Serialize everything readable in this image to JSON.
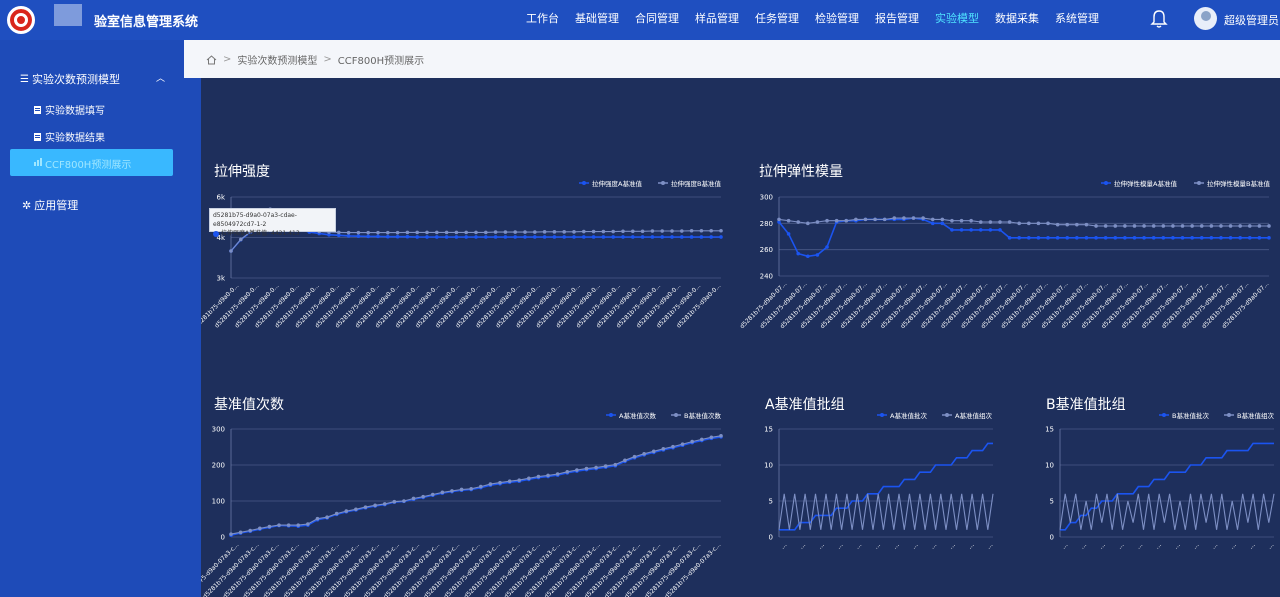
{
  "header": {
    "app_title": "验室信息管理系统",
    "nav": [
      "工作台",
      "基础管理",
      "合同管理",
      "样品管理",
      "任务管理",
      "检验管理",
      "报告管理",
      "实验模型",
      "数据采集",
      "系统管理"
    ],
    "active_nav": "实验模型",
    "user_name": "超级管理员"
  },
  "sidebar": {
    "group_label": "实验次数预测模型",
    "items": [
      "实验数据填写",
      "实验数据结果",
      "CCF800H预测展示"
    ],
    "active_item": "CCF800H预测展示",
    "app_label": "应用管理"
  },
  "breadcrumb": [
    "实验次数预测模型",
    "CCF800H预测展示"
  ],
  "tooltip": {
    "title": "d5281b75-d9a0-07a3-cdae-e8504972cd7-1-2",
    "series": "拉伸强度A基准值",
    "value": "4421.413"
  },
  "colors": {
    "seriesA": "#1b54f0",
    "seriesB": "#7d8fc4",
    "panel": "#1e2f5c",
    "accent": "#39b8ff"
  },
  "chart_data": [
    {
      "type": "line",
      "title": "拉伸强度",
      "tick_label_pattern": "d5281b75-d9a0-0...",
      "yticks": [
        "3k",
        "4k",
        "6k"
      ],
      "ylim": [
        3000,
        6000
      ],
      "grid": true,
      "legend": "top-right",
      "series": [
        {
          "name": "拉伸强度A基准值",
          "values": [
            4000,
            4420,
            4700,
            5200,
            5500,
            5100,
            4900,
            4800,
            4700,
            4650,
            4600,
            4580,
            4560,
            4550,
            4540,
            4540,
            4530,
            4530,
            4530,
            4520,
            4520,
            4520,
            4520,
            4520,
            4520,
            4520,
            4520,
            4520,
            4520,
            4520,
            4520,
            4520,
            4520,
            4520,
            4520,
            4520,
            4520,
            4520,
            4520,
            4520,
            4520,
            4520,
            4520,
            4520,
            4520,
            4520,
            4520,
            4520,
            4520,
            4520,
            4520
          ]
        },
        {
          "name": "拉伸强度B基准值",
          "values": [
            4000,
            4430,
            4720,
            5250,
            5550,
            5300,
            5100,
            4950,
            4800,
            4720,
            4700,
            4690,
            4680,
            4680,
            4680,
            4680,
            4680,
            4680,
            4690,
            4690,
            4690,
            4690,
            4690,
            4690,
            4690,
            4690,
            4690,
            4700,
            4700,
            4700,
            4700,
            4700,
            4710,
            4710,
            4710,
            4710,
            4720,
            4720,
            4720,
            4720,
            4730,
            4730,
            4730,
            4740,
            4740,
            4740,
            4740,
            4750,
            4750,
            4750,
            4750
          ]
        }
      ]
    },
    {
      "type": "line",
      "title": "拉伸弹性模量",
      "tick_label_pattern": "d5281b75-d9a0-07...",
      "yticks": [
        "240",
        "260",
        "280",
        "300"
      ],
      "ylim": [
        240,
        300
      ],
      "grid": true,
      "legend": "top-right",
      "series": [
        {
          "name": "拉伸弹性模量A基准值",
          "values": [
            281,
            272,
            257,
            255,
            256,
            262,
            281,
            282,
            282,
            283,
            283,
            283,
            283,
            283,
            284,
            283,
            280,
            280,
            275,
            275,
            275,
            275,
            275,
            275,
            269,
            269,
            269,
            269,
            269,
            269,
            269,
            269,
            269,
            269,
            269,
            269,
            269,
            269,
            269,
            269,
            269,
            269,
            269,
            269,
            269,
            269,
            269,
            269,
            269,
            269,
            269,
            269
          ]
        },
        {
          "name": "拉伸弹性模量B基准值",
          "values": [
            283,
            282,
            281,
            280,
            281,
            282,
            282,
            282,
            283,
            283,
            283,
            283,
            284,
            284,
            284,
            284,
            283,
            283,
            282,
            282,
            282,
            281,
            281,
            281,
            281,
            280,
            280,
            280,
            280,
            279,
            279,
            279,
            279,
            278,
            278,
            278,
            278,
            278,
            278,
            278,
            278,
            278,
            278,
            278,
            278,
            278,
            278,
            278,
            278,
            278,
            278,
            278
          ]
        }
      ]
    },
    {
      "type": "line",
      "title": "基准值次数",
      "tick_label_pattern": "d5281b75-d9a0-07a3-c...",
      "yticks": [
        "0",
        "100",
        "200",
        "300"
      ],
      "ylim": [
        0,
        300
      ],
      "grid": true,
      "legend": "top-right",
      "series": [
        {
          "name": "A基准值次数",
          "values": [
            5,
            11,
            16,
            22,
            27,
            32,
            31,
            30,
            33,
            48,
            53,
            63,
            70,
            75,
            81,
            86,
            90,
            97,
            99,
            105,
            110,
            116,
            122,
            126,
            130,
            132,
            137,
            144,
            148,
            152,
            155,
            160,
            165,
            168,
            172,
            178,
            183,
            187,
            190,
            194,
            198,
            210,
            220,
            228,
            235,
            242,
            248,
            255,
            262,
            268,
            274,
            278
          ]
        },
        {
          "name": "B基准值次数",
          "values": [
            8,
            13,
            18,
            24,
            29,
            33,
            33,
            33,
            36,
            51,
            55,
            65,
            72,
            77,
            83,
            88,
            92,
            98,
            100,
            107,
            112,
            118,
            124,
            128,
            132,
            134,
            140,
            147,
            151,
            155,
            158,
            163,
            168,
            171,
            175,
            181,
            186,
            190,
            193,
            197,
            201,
            213,
            223,
            231,
            238,
            245,
            251,
            258,
            265,
            271,
            277,
            281
          ]
        }
      ]
    },
    {
      "type": "line",
      "title": "A基准值批组",
      "tick_label_pattern": "…",
      "yticks": [
        "0",
        "5",
        "10",
        "15"
      ],
      "ylim": [
        0,
        15
      ],
      "grid": true,
      "legend": "top-right",
      "series": [
        {
          "name": "A基准值批次",
          "values": [
            1,
            1,
            1,
            1,
            2,
            2,
            2,
            3,
            3,
            3,
            3,
            4,
            4,
            4,
            5,
            5,
            5,
            6,
            6,
            6,
            7,
            7,
            7,
            7,
            8,
            8,
            8,
            9,
            9,
            9,
            10,
            10,
            10,
            10,
            11,
            11,
            11,
            12,
            12,
            12,
            13,
            13
          ]
        },
        {
          "name": "A基准值组次",
          "values": [
            1,
            6,
            1,
            6,
            1,
            6,
            1,
            6,
            1,
            6,
            1,
            6,
            1,
            6,
            1,
            6,
            1,
            6,
            1,
            6,
            1,
            6,
            1,
            6,
            1,
            6,
            1,
            6,
            1,
            6,
            1,
            6,
            1,
            6,
            1,
            6,
            1,
            6,
            1,
            6,
            1,
            6
          ]
        }
      ]
    },
    {
      "type": "line",
      "title": "B基准值批组",
      "tick_label_pattern": "…",
      "yticks": [
        "0",
        "5",
        "10",
        "15"
      ],
      "ylim": [
        0,
        15
      ],
      "grid": true,
      "legend": "top-right",
      "series": [
        {
          "name": "B基准值批次",
          "values": [
            1,
            1,
            2,
            2,
            3,
            3,
            4,
            4,
            5,
            5,
            5,
            6,
            6,
            6,
            6,
            7,
            7,
            7,
            8,
            8,
            8,
            9,
            9,
            9,
            9,
            10,
            10,
            10,
            11,
            11,
            11,
            11,
            12,
            12,
            12,
            12,
            12,
            13,
            13,
            13,
            13,
            13
          ]
        },
        {
          "name": "B基准值组次",
          "values": [
            1,
            6,
            2,
            6,
            1,
            5,
            1,
            6,
            2,
            6,
            1,
            6,
            1,
            5,
            2,
            6,
            1,
            6,
            1,
            6,
            2,
            6,
            1,
            5,
            1,
            6,
            1,
            6,
            2,
            6,
            1,
            6,
            1,
            5,
            1,
            6,
            2,
            6,
            1,
            6,
            2,
            6
          ]
        }
      ]
    }
  ]
}
